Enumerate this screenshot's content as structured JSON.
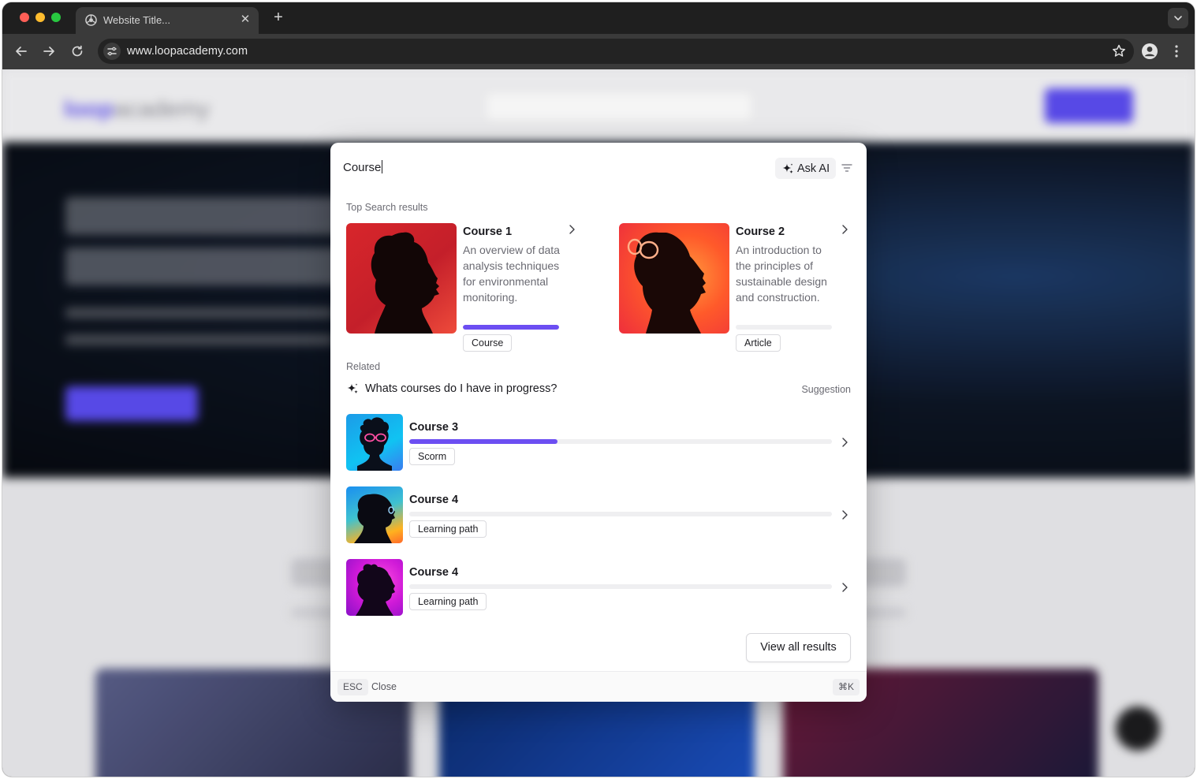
{
  "browser": {
    "tab_title": "Website Title...",
    "url": "www.loopacademy.com"
  },
  "background_page": {
    "logo_brand": "loop",
    "logo_suffix": "academy"
  },
  "palette": {
    "query": "Course",
    "ask_ai_label": "Ask AI",
    "top_results_label": "Top Search results",
    "top_results": [
      {
        "title": "Course 1",
        "description": "An overview of data analysis techniques for environmental monitoring.",
        "progress": 1.0,
        "badge": "Course"
      },
      {
        "title": "Course 2",
        "description": "An introduction to the principles of sustainable design and construction.",
        "progress": 0.0,
        "badge": "Article"
      }
    ],
    "related_label": "Related",
    "suggestion": {
      "text": "Whats courses do I have in progress?",
      "tag": "Suggestion"
    },
    "related_items": [
      {
        "title": "Course 3",
        "badge": "Scorm",
        "progress": 0.35
      },
      {
        "title": "Course 4",
        "badge": "Learning path",
        "progress": 0.0
      },
      {
        "title": "Course 4",
        "badge": "Learning path",
        "progress": 0.0
      }
    ],
    "view_all_label": "View all results",
    "footer": {
      "esc_key": "ESC",
      "close_label": "Close",
      "shortcut": "⌘K"
    }
  },
  "colors": {
    "accent": "#6c4ef2",
    "traffic_red": "#ff5f57",
    "traffic_yellow": "#febc2e",
    "traffic_green": "#28c840"
  }
}
